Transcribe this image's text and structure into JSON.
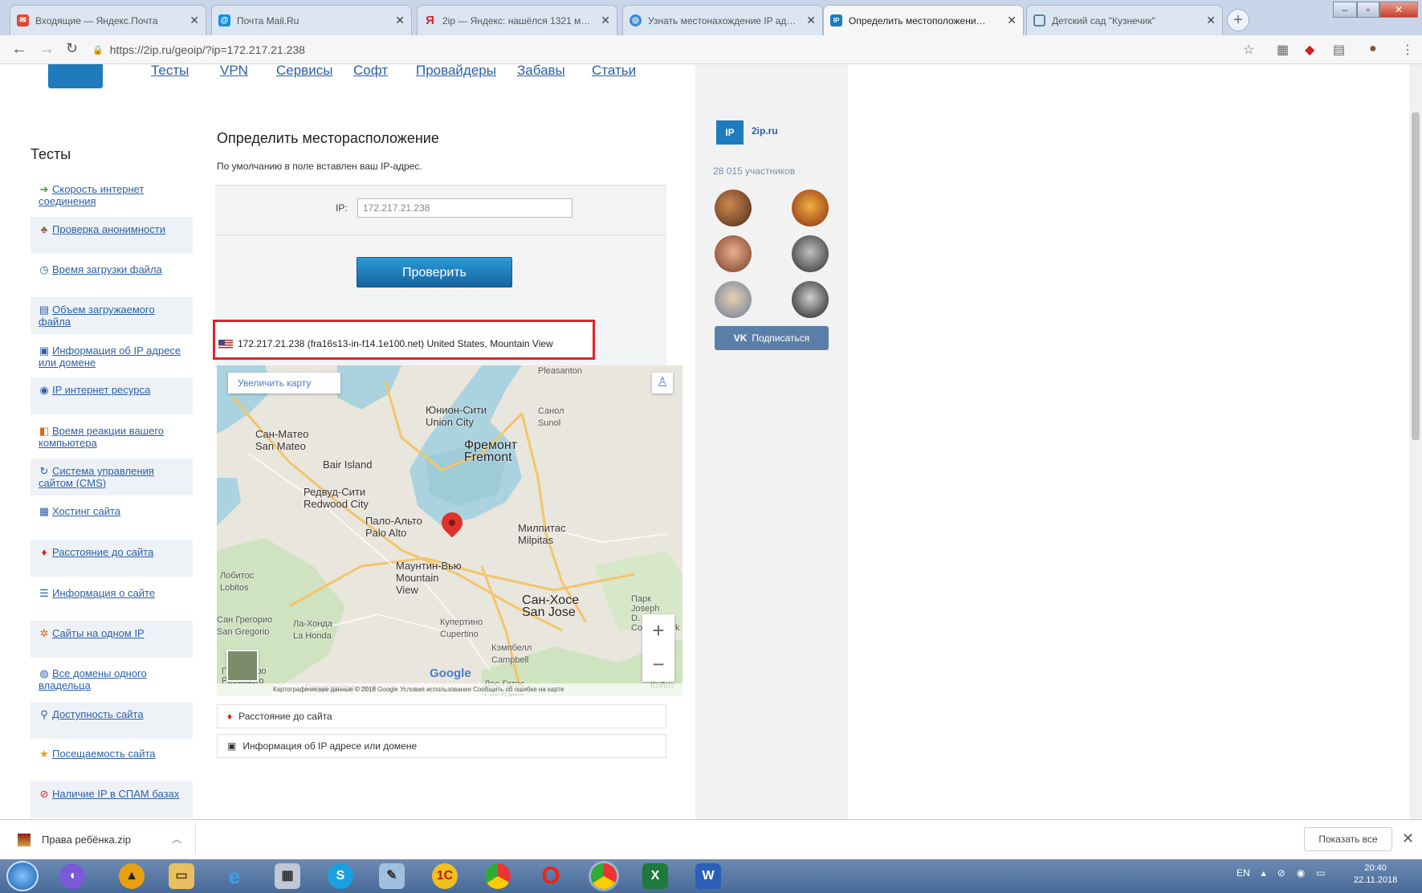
{
  "browser": {
    "tabs": [
      {
        "title": "Входящие — Яндекс.Почта",
        "icon": "yandex-mail-icon",
        "color": "#e04a2f",
        "letter": "✉"
      },
      {
        "title": "Почта Mail.Ru",
        "icon": "mailru-icon",
        "color": "#168de2",
        "letter": "@"
      },
      {
        "title": "2ip — Яндекс: нашёлся 1321 м…",
        "icon": "yandex-icon",
        "color": "#e02020",
        "letter": "Я"
      },
      {
        "title": "Узнать местонахождение IP ад…",
        "icon": "globe-icon",
        "color": "#3a8ad6",
        "letter": "◎"
      },
      {
        "title": "Определить местоположени…",
        "icon": "2ip-icon",
        "color": "#1e7bbd",
        "letter": "IP"
      },
      {
        "title": "Детский сад \"Кузнечик\"",
        "icon": "page-icon",
        "color": "#5b7fa6",
        "letter": "▢"
      }
    ],
    "url": "https://2ip.ru/geoip/?ip=172.217.21.238"
  },
  "nav": {
    "items": [
      "Тесты",
      "VPN",
      "Сервисы",
      "Софт",
      "Провайдеры",
      "Забавы",
      "Статьи"
    ]
  },
  "sidebar": {
    "title": "Тесты",
    "items": [
      {
        "label": "Скорость интернет соединения",
        "icon": "speed-icon"
      },
      {
        "label": "Проверка анонимности",
        "icon": "spy-icon"
      },
      {
        "label": "Время загрузки файла",
        "icon": "clock-icon"
      },
      {
        "label": "Объем загружаемого файла",
        "icon": "file-size-icon"
      },
      {
        "label": "Информация об IP адресе или домене",
        "icon": "ip-info-icon"
      },
      {
        "label": "IP интернет ресурса",
        "icon": "ip-resource-icon"
      },
      {
        "label": "Время реакции вашего компьютера",
        "icon": "reaction-icon"
      },
      {
        "label": "Система управления сайтом (CMS)",
        "icon": "cms-icon"
      },
      {
        "label": "Хостинг сайта",
        "icon": "hosting-icon"
      },
      {
        "label": "Расстояние до сайта",
        "icon": "pin-icon"
      },
      {
        "label": "Информация о сайте",
        "icon": "site-info-icon"
      },
      {
        "label": "Сайты на одном IP",
        "icon": "sites-icon"
      },
      {
        "label": "Все домены одного владельца",
        "icon": "domains-icon"
      },
      {
        "label": "Доступность сайта",
        "icon": "availability-icon"
      },
      {
        "label": "Посещаемость сайта",
        "icon": "star-icon"
      },
      {
        "label": "Наличие IP в СПАМ базах",
        "icon": "spam-icon"
      }
    ]
  },
  "main": {
    "title": "Определить месторасположение",
    "subtitle": "По умолчанию в поле вставлен ваш IP-адрес.",
    "ip_label": "IP:",
    "ip_value": "172.217.21.238",
    "check_button": "Проверить",
    "result": "172.217.21.238 (fra16s13-in-f14.1e100.net) United States, Mountain View"
  },
  "map": {
    "enlarge": "Увеличить карту",
    "zoom_in": "+",
    "zoom_out": "−",
    "google": "Google",
    "footer": "Картографические данные © 2018 Google   Условия использования   Сообщить об ошибке на карте",
    "labels": {
      "union_city": "Юнион-Сити\nUnion City",
      "san_mateo": "Сан-Матео\nSan Mateo",
      "fremont": "Фремонт\nFremont",
      "bair_island": "Bair Island",
      "redwood": "Редвуд-Сити\nRedwood City",
      "palo_alto": "Пало-Альто\nPalo Alto",
      "milpitas": "Милпитас\nMilpitas",
      "mountain_view": "Маунтин-Вью\nMountain\nView",
      "san_jose": "Сан-Хосе\nSan Jose",
      "cupertino": "Купертино\nCupertino",
      "campbell": "Кэмпбелл\nCampbell",
      "los_gatos": "Лос-Гатос\nLos Gatos",
      "lobitos": "Лобитос\nLobitos",
      "la_honda": "Ла-Хонда\nLa Honda",
      "san_gregorio": "Сан Грегорио\nSan Gregorio",
      "pleasanton": "Pleasanton",
      "sunol": "Санол\nSunol",
      "joseph": "Парк\nJoseph\nD. Grant\nCounty Park",
      "pescadero": "Пескадеро\nPescadero",
      "state": "Государственный",
      "koyot": "Койот"
    }
  },
  "list_rows": [
    "Расстояние до сайта",
    "Информация об IP адресе или домене"
  ],
  "vk": {
    "name": "2ip.ru",
    "members": "28 015 участников",
    "subscribe": "Подписаться"
  },
  "download": {
    "file": "Права ребёнка.zip",
    "show_all": "Показать все"
  },
  "taskbar": {
    "lang": "EN",
    "time": "20:40",
    "date": "22.11.2018"
  }
}
